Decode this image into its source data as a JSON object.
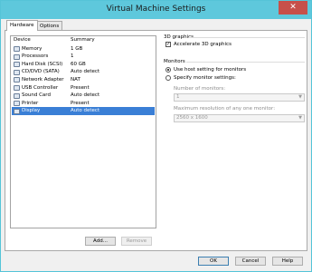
{
  "window": {
    "title": "Virtual Machine Settings",
    "close_glyph": "✕"
  },
  "tabs": [
    {
      "label": "Hardware",
      "active": true
    },
    {
      "label": "Options",
      "active": false
    }
  ],
  "device_list": {
    "headers": {
      "device": "Device",
      "summary": "Summary"
    },
    "rows": [
      {
        "name": "Memory",
        "summary": "1 GB",
        "icon": "memory-icon",
        "selected": false
      },
      {
        "name": "Processors",
        "summary": "1",
        "icon": "processor-icon",
        "selected": false
      },
      {
        "name": "Hard Disk (SCSI)",
        "summary": "60 GB",
        "icon": "hard-disk-icon",
        "selected": false
      },
      {
        "name": "CD/DVD (SATA)",
        "summary": "Auto detect",
        "icon": "cd-dvd-icon",
        "selected": false
      },
      {
        "name": "Network Adapter",
        "summary": "NAT",
        "icon": "network-adapter-icon",
        "selected": false
      },
      {
        "name": "USB Controller",
        "summary": "Present",
        "icon": "usb-controller-icon",
        "selected": false
      },
      {
        "name": "Sound Card",
        "summary": "Auto detect",
        "icon": "sound-card-icon",
        "selected": false
      },
      {
        "name": "Printer",
        "summary": "Present",
        "icon": "printer-icon",
        "selected": false
      },
      {
        "name": "Display",
        "summary": "Auto detect",
        "icon": "display-icon",
        "selected": true
      }
    ]
  },
  "list_buttons": {
    "add": "Add...",
    "remove": "Remove"
  },
  "graphics": {
    "section_title": "3D graphics",
    "accelerate_label": "Accelerate 3D graphics",
    "accelerate_checked": true
  },
  "monitors": {
    "section_title": "Monitors",
    "use_host_label": "Use host setting for monitors",
    "specify_label": "Specify monitor settings:",
    "number_label": "Number of monitors:",
    "number_value": "1",
    "max_res_label": "Maximum resolution of any one monitor:",
    "max_res_value": "2560 x 1600"
  },
  "footer_buttons": {
    "ok": "OK",
    "cancel": "Cancel",
    "help": "Help"
  },
  "colors": {
    "titlebar": "#5ec8dc",
    "selection": "#3a7fd6",
    "close": "#c7504a"
  }
}
